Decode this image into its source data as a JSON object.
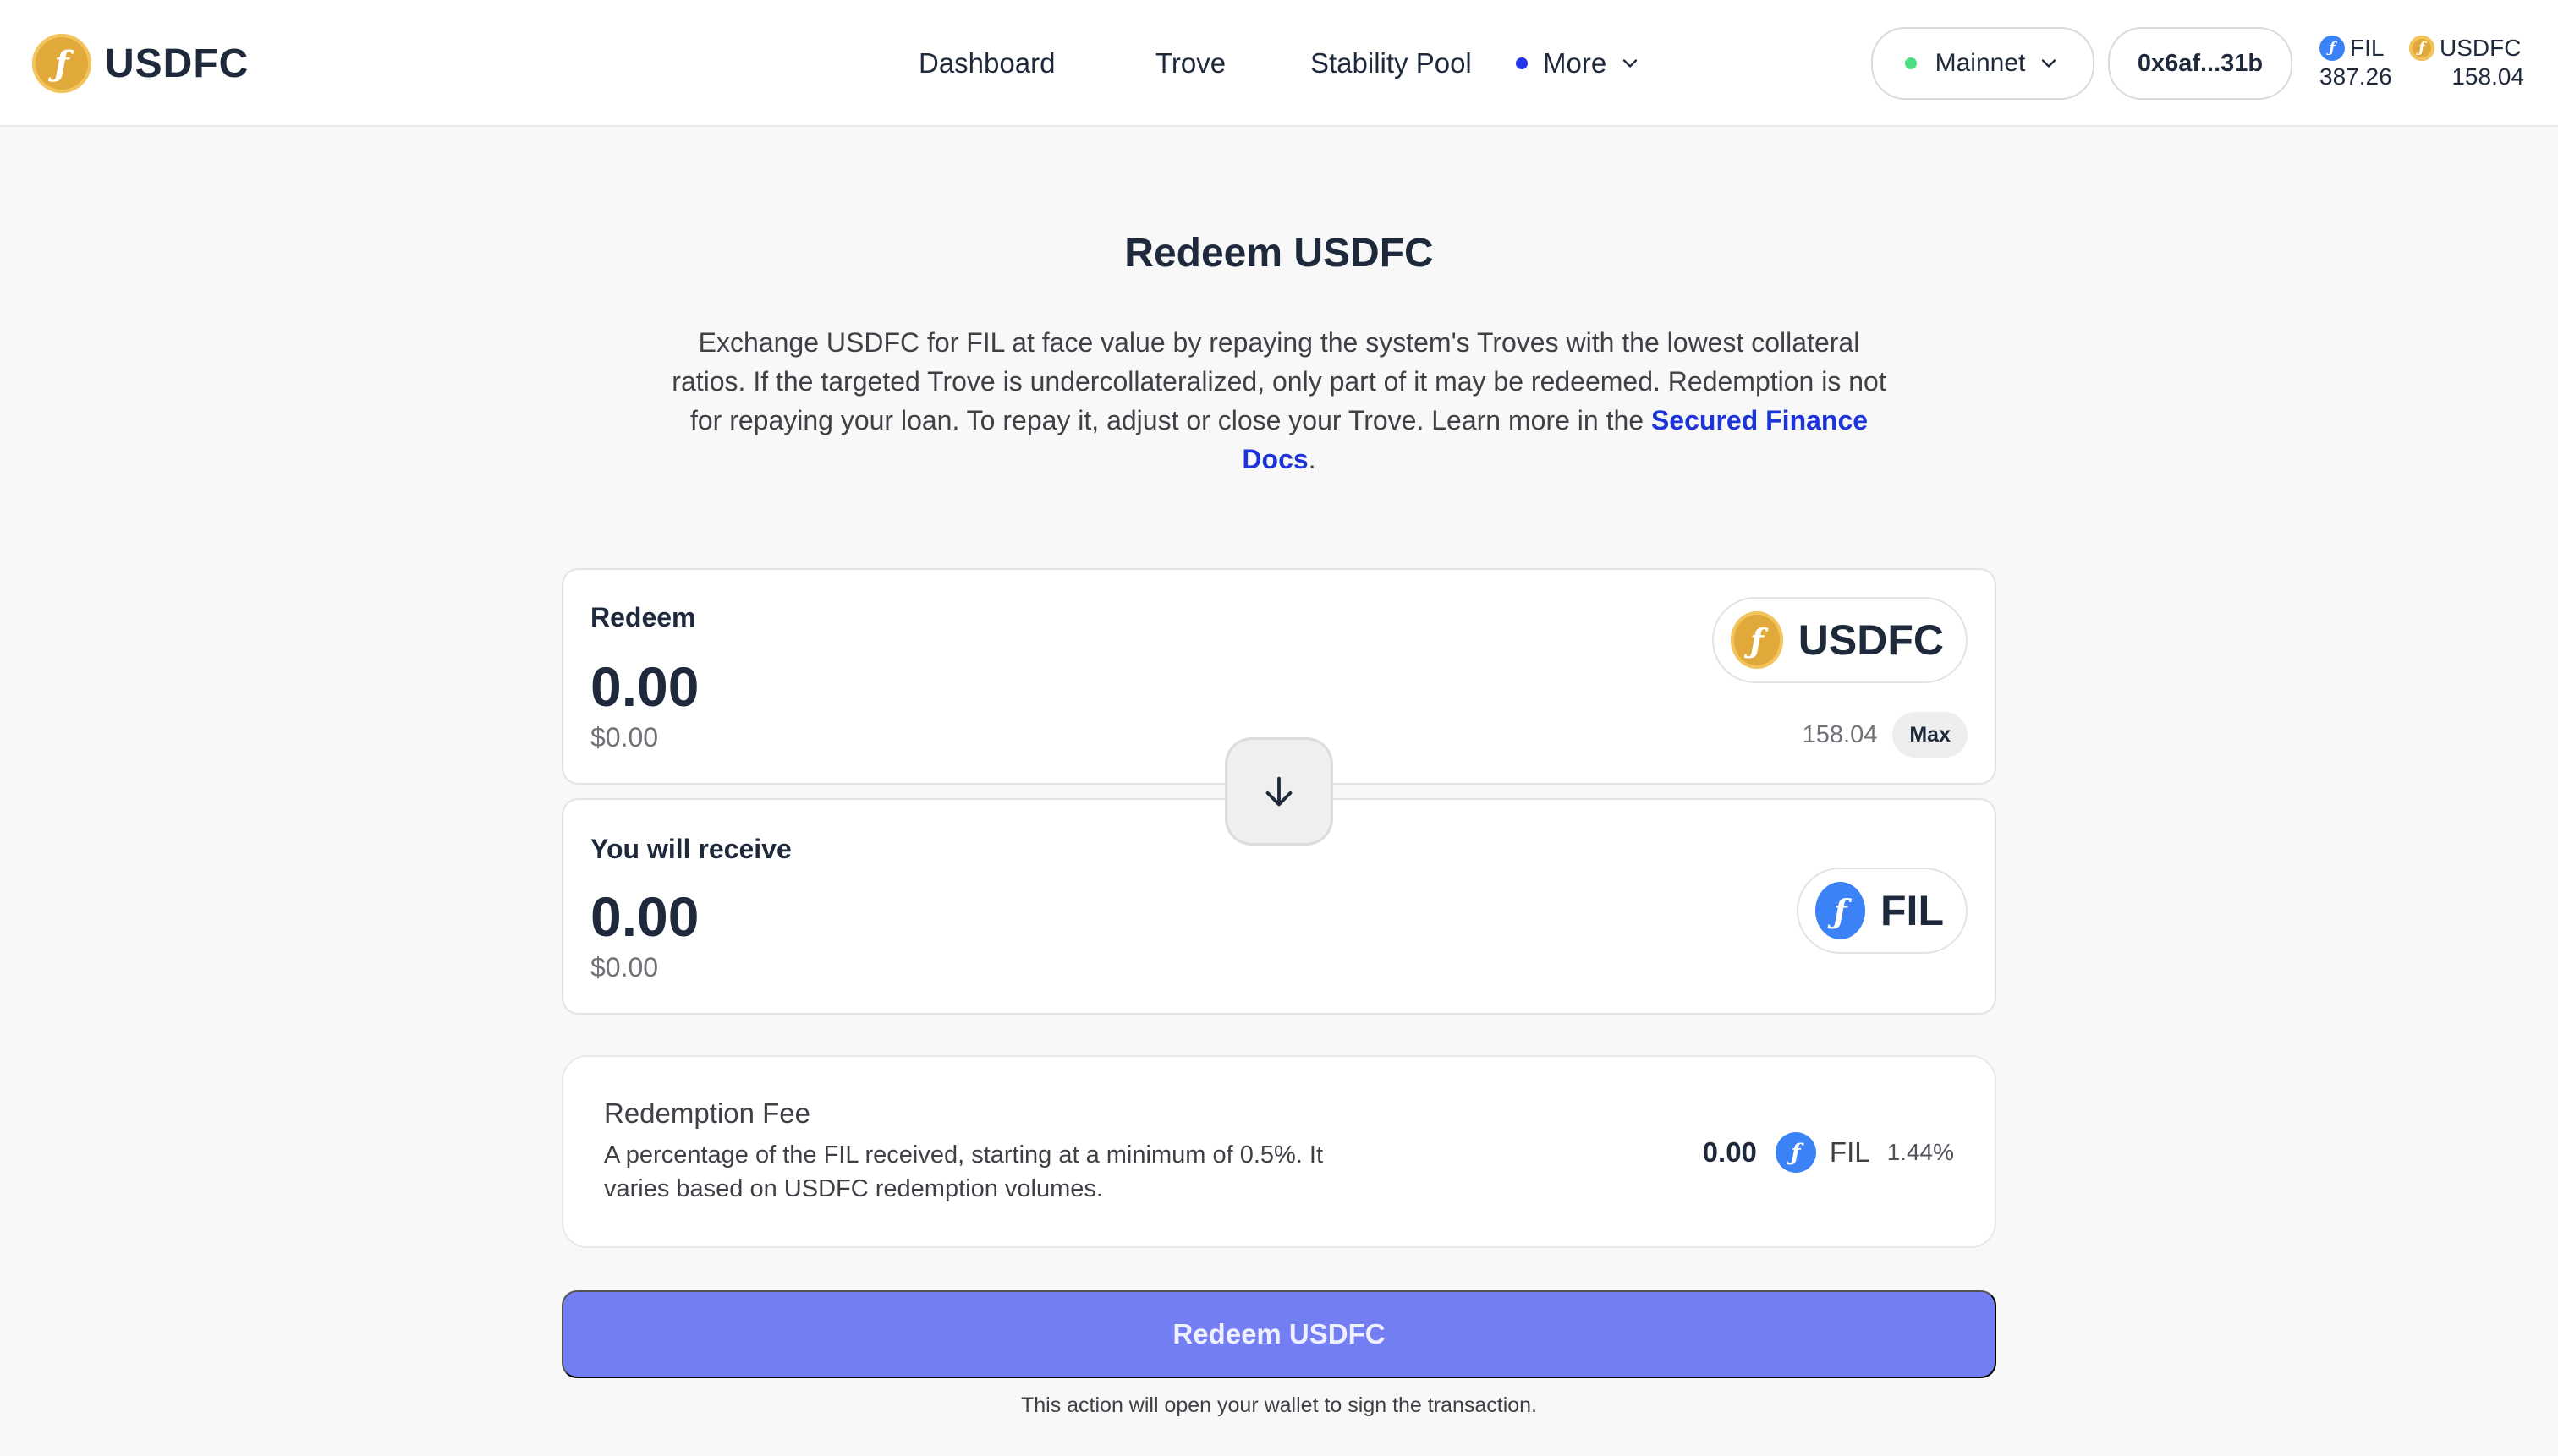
{
  "header": {
    "brand": "USDFC",
    "nav": {
      "dashboard": "Dashboard",
      "trove": "Trove",
      "stability_pool": "Stability Pool",
      "more": "More"
    },
    "network": "Mainnet",
    "wallet_address": "0x6af...31b",
    "balances": {
      "fil": {
        "symbol": "FIL",
        "amount": "387.26"
      },
      "usdfc": {
        "symbol": "USDFC",
        "amount": "158.04"
      }
    }
  },
  "page": {
    "title": "Redeem USDFC",
    "description": "Exchange USDFC for FIL at face value by repaying the system's Troves with the lowest collateral ratios. If the targeted Trove is undercollateralized, only part of it may be redeemed. Redemption is not for repaying your loan. To repay it, adjust or close your Trove. Learn more in the ",
    "docs_link": "Secured Finance Docs",
    "description_end": "."
  },
  "redeem_card": {
    "label": "Redeem",
    "amount": "0.00",
    "usd_value": "$0.00",
    "token": "USDFC",
    "balance": "158.04",
    "max_label": "Max"
  },
  "receive_card": {
    "label": "You will receive",
    "amount": "0.00",
    "usd_value": "$0.00",
    "token": "FIL"
  },
  "fee": {
    "title": "Redemption Fee",
    "description": "A percentage of the FIL received, starting at a minimum of 0.5%. It varies based on USDFC redemption volumes.",
    "amount": "0.00",
    "token": "FIL",
    "percent": "1.44%"
  },
  "action": {
    "button_label": "Redeem USDFC",
    "note": "This action will open your wallet to sign the transaction."
  },
  "colors": {
    "usdfc_coin": "#e0a93a",
    "fil_coin": "#3b82f6",
    "primary_button": "#747ef3",
    "link": "#1d35d8",
    "network_status": "#4ade80"
  },
  "icons": {
    "coin_glyph": "ƒ",
    "more": "chevron-down-icon",
    "swap": "arrow-down-icon"
  }
}
